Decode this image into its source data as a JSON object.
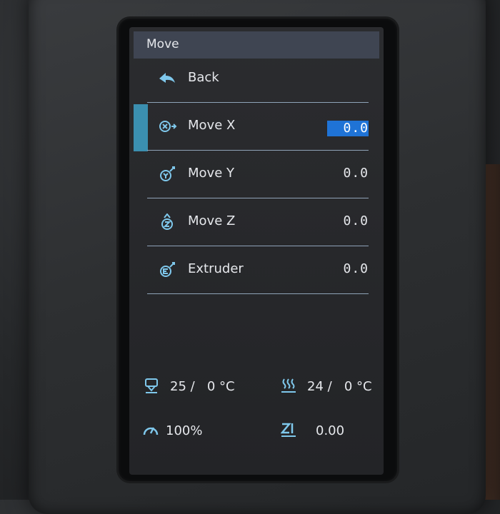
{
  "title": "Move",
  "menu": [
    {
      "label": "Back",
      "value": "",
      "icon": "back-arrow-icon"
    },
    {
      "label": "Move X",
      "value": "0.0",
      "icon": "move-x-icon",
      "selected": true
    },
    {
      "label": "Move Y",
      "value": "0.0",
      "icon": "move-y-icon"
    },
    {
      "label": "Move Z",
      "value": "0.0",
      "icon": "move-z-icon"
    },
    {
      "label": "Extruder",
      "value": "0.0",
      "icon": "extruder-icon"
    }
  ],
  "status": {
    "hotend": "25 /   0 °C",
    "bed": "24 /   0 °C",
    "speed": "100%",
    "z_offset": "0.00"
  },
  "colors": {
    "accent": "#7fc8ec",
    "selection": "#1f73d6",
    "titlebar": "#3f4552"
  }
}
